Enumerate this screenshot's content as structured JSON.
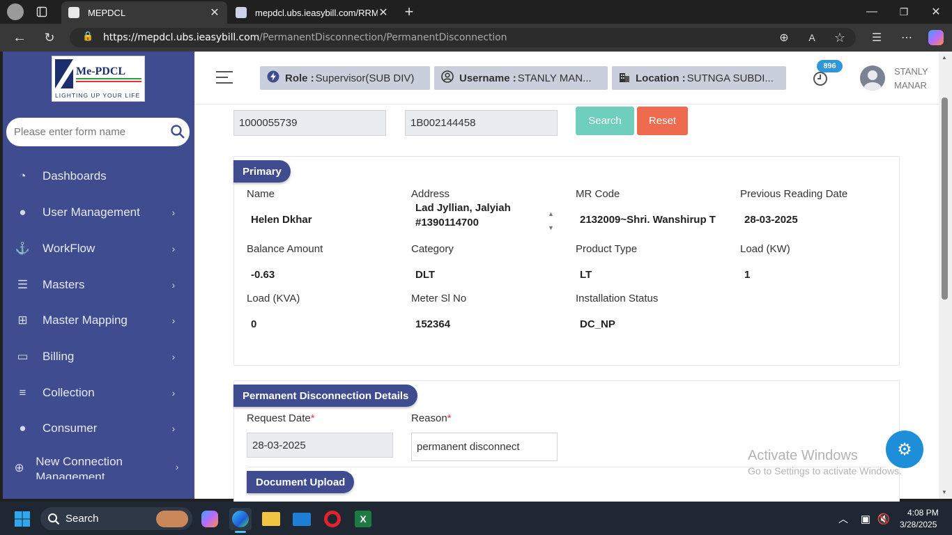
{
  "browser": {
    "tabs": [
      {
        "title": "MEPDCL",
        "active": true
      },
      {
        "title": "mepdcl.ubs.ieasybill.com/RRMaste",
        "active": false
      }
    ],
    "url_host": "https://mepdcl.ubs.ieasybill.com",
    "url_path": "/PermanentDisconnection/PermanentDisconnection"
  },
  "sidebar": {
    "logo_text": "Me-PDCL",
    "logo_tagline": "LIGHTING UP YOUR LIFE",
    "search_placeholder": "Please enter form name",
    "items": [
      {
        "label": "Dashboards",
        "icon": "dashboard-icon"
      },
      {
        "label": "User Management",
        "icon": "user-icon"
      },
      {
        "label": "WorkFlow",
        "icon": "anchor-icon"
      },
      {
        "label": "Masters",
        "icon": "server-icon"
      },
      {
        "label": "Master Mapping",
        "icon": "sitemap-icon"
      },
      {
        "label": "Billing",
        "icon": "monitor-icon"
      },
      {
        "label": "Collection",
        "icon": "list-icon"
      },
      {
        "label": "Consumer",
        "icon": "user-icon"
      },
      {
        "label": "New Connection Management",
        "icon": "plus-circle-icon"
      }
    ]
  },
  "header": {
    "role_label": "Role :",
    "role_value": "Supervisor(SUB DIV)",
    "username_label": "Username :",
    "username_value": "STANLY MAN...",
    "location_label": "Location :",
    "location_value": "SUTNGA SUBDI...",
    "notification_count": "896",
    "user_name_line1": "STANLY",
    "user_name_line2": "MANAR"
  },
  "search_row": {
    "field1_value": "1000055739",
    "field2_value": "1B002144458",
    "search_label": "Search",
    "reset_label": "Reset"
  },
  "primary": {
    "title": "Primary",
    "fields": [
      {
        "label": "Name",
        "value": "Helen Dkhar"
      },
      {
        "label": "Address",
        "value_line1": "Lad Jyllian, Jalyiah",
        "value_line2": "#1390114700"
      },
      {
        "label": "MR Code",
        "value": "2132009~Shri. Wanshirup T"
      },
      {
        "label": "Previous Reading Date",
        "value": "28-03-2025"
      },
      {
        "label": "Balance Amount",
        "value": "-0.63"
      },
      {
        "label": "Category",
        "value": "DLT"
      },
      {
        "label": "Product Type",
        "value": "LT"
      },
      {
        "label": "Load (KW)",
        "value": "1"
      },
      {
        "label": "Load (KVA)",
        "value": "0"
      },
      {
        "label": "Meter Sl No",
        "value": "152364"
      },
      {
        "label": "Installation Status",
        "value": "DC_NP"
      }
    ]
  },
  "pd_details": {
    "title": "Permanent Disconnection Details",
    "request_date_label": "Request Date",
    "request_date_value": "28-03-2025",
    "reason_label": "Reason",
    "reason_value": "permanent disconnect",
    "required_mark": "*"
  },
  "document_upload": {
    "title": "Document Upload"
  },
  "watermark": {
    "line1": "Activate Windows",
    "line2": "Go to Settings to activate Windows."
  },
  "taskbar": {
    "search_label": "Search",
    "time": "4:08 PM",
    "date": "3/28/2025"
  },
  "colors": {
    "sidebar": "#3f4c8f",
    "search_button": "#6fcfbf",
    "reset_button": "#ef6b4f",
    "settings_fab": "#1f8ed8"
  }
}
